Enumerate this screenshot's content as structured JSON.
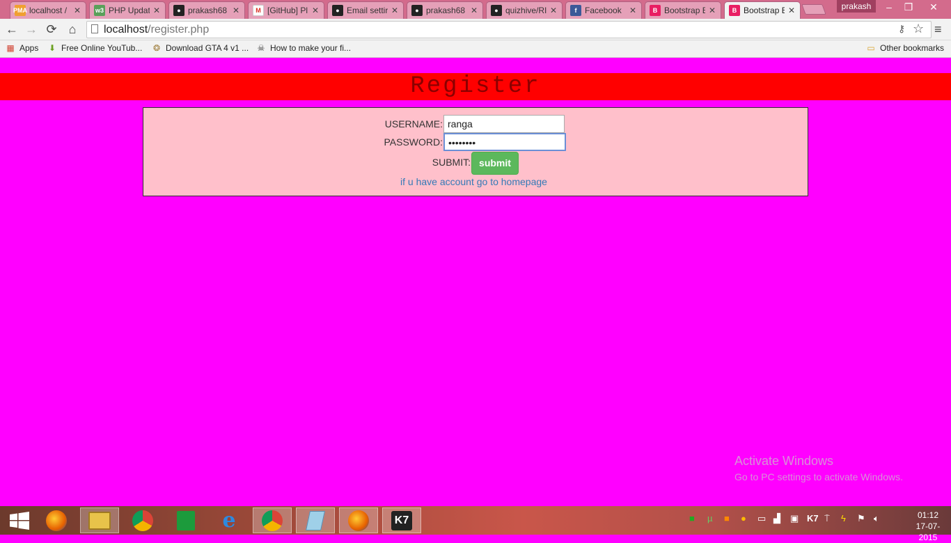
{
  "browser": {
    "tabs": [
      {
        "title": "localhost /",
        "icon": "phpmyadmin-icon",
        "color": "#f0a030",
        "glyph": "PMA"
      },
      {
        "title": "PHP Updat",
        "icon": "w3schools-icon",
        "color": "#5aa05a",
        "glyph": "w3"
      },
      {
        "title": "prakash68",
        "icon": "github-icon",
        "color": "#222222",
        "glyph": "●"
      },
      {
        "title": "[GitHub] Pl",
        "icon": "gmail-icon",
        "color": "#ffffff",
        "glyph": "M"
      },
      {
        "title": "Email settir",
        "icon": "github-icon",
        "color": "#222222",
        "glyph": "●"
      },
      {
        "title": "prakash68",
        "icon": "github-icon",
        "color": "#222222",
        "glyph": "●"
      },
      {
        "title": "quizhive/RI",
        "icon": "github-icon",
        "color": "#222222",
        "glyph": "●"
      },
      {
        "title": "Facebook",
        "icon": "facebook-icon",
        "color": "#3b5998",
        "glyph": "f"
      },
      {
        "title": "Bootstrap E",
        "icon": "bootstrap-icon",
        "color": "#e91e63",
        "glyph": "B"
      },
      {
        "title": "Bootstrap E",
        "icon": "bootstrap-icon",
        "color": "#e91e63",
        "glyph": "B"
      }
    ],
    "user": "prakash",
    "url_host": "localhost",
    "url_path": "/register.php",
    "bookmarks": [
      {
        "label": "Apps",
        "icon": "apps-grid-icon"
      },
      {
        "label": "Free Online YouTub...",
        "icon": "download-arrow-icon"
      },
      {
        "label": "Download GTA 4 v1 ...",
        "icon": "badge-icon"
      },
      {
        "label": "How to make your fi...",
        "icon": "robot-icon"
      }
    ],
    "other_bookmarks": "Other bookmarks"
  },
  "page": {
    "title": "Register",
    "form": {
      "username_label": "USERNAME:",
      "username_value": "ranga",
      "password_label": "PASSWORD:",
      "password_value": "••••••••",
      "submit_label": "SUBMIT:",
      "submit_button": "submit",
      "homepage_link": "if u have account go to homepage"
    }
  },
  "watermark": {
    "line1": "Activate Windows",
    "line2": "Go to PC settings to activate Windows."
  },
  "taskbar": {
    "time": "01:12",
    "date": "17-07-2015",
    "apps": [
      "start-icon",
      "firefox-icon",
      "file-explorer-icon",
      "chrome-icon",
      "store-icon",
      "internet-explorer-icon",
      "chrome-icon",
      "notepad-icon",
      "firefox-icon",
      "k7-antivirus-icon"
    ]
  }
}
